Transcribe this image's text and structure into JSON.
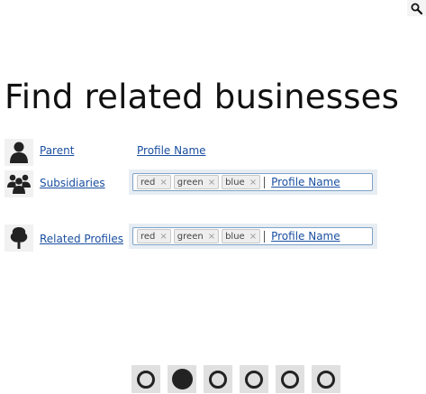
{
  "header": {
    "search_icon": "search-icon"
  },
  "page": {
    "title": "Find related businesses"
  },
  "rows": [
    {
      "icon": "person-icon",
      "label": "Parent",
      "name_link": "Profile Name"
    },
    {
      "icon": "group-icon",
      "label": "Subsidiaries",
      "tags": [
        "red",
        "green",
        "blue"
      ],
      "name_link": "Profile Name"
    },
    {
      "icon": "tree-icon",
      "label": "Related Profiles",
      "tags": [
        "red",
        "green",
        "blue"
      ],
      "name_link": "Profile Name"
    }
  ],
  "tag_remove_glyph": "×",
  "pager": {
    "count": 6,
    "active_index": 2
  },
  "colors": {
    "link": "#1a4fa0",
    "field_border": "#7fa3c8",
    "field_background": "#e7edf3"
  }
}
